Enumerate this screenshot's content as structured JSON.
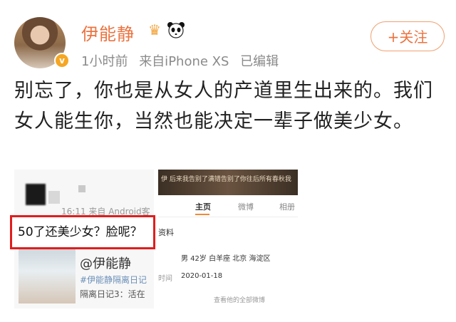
{
  "post": {
    "username": "伊能静",
    "follow_label": "+关注",
    "time": "1小时前",
    "source": "来自iPhone XS",
    "edited": "已编辑",
    "verified_mark": "v",
    "crown_icon_glyph": "♛",
    "text": "别忘了，你也是从女人的产道里生出来的。我们女人能生你，当然也能决定一辈子做美少女。"
  },
  "embedded_left": {
    "timestamp": "16:11  来自 Android客",
    "highlight_comment": "50了还美少女？脸呢？",
    "mention": "@伊能静",
    "hashtag": "#伊能静隔离日记",
    "sub_line": "隔离日记3：活在"
  },
  "embedded_right": {
    "cover_text": "伊 后来我告别了满错告别了你往后所有春秋我",
    "tabs": [
      "主页",
      "微博",
      "相册"
    ],
    "profile_heading": "资料",
    "profile_info": "男  42岁  白羊座  北京 海淀区",
    "date_label": "时间",
    "date_value": "2020-01-18",
    "all_posts": "查看他的全部微博"
  },
  "colors": {
    "username": "#eb7340",
    "highlight_border": "#e11d1d",
    "meta_gray": "#8a8a8a"
  }
}
